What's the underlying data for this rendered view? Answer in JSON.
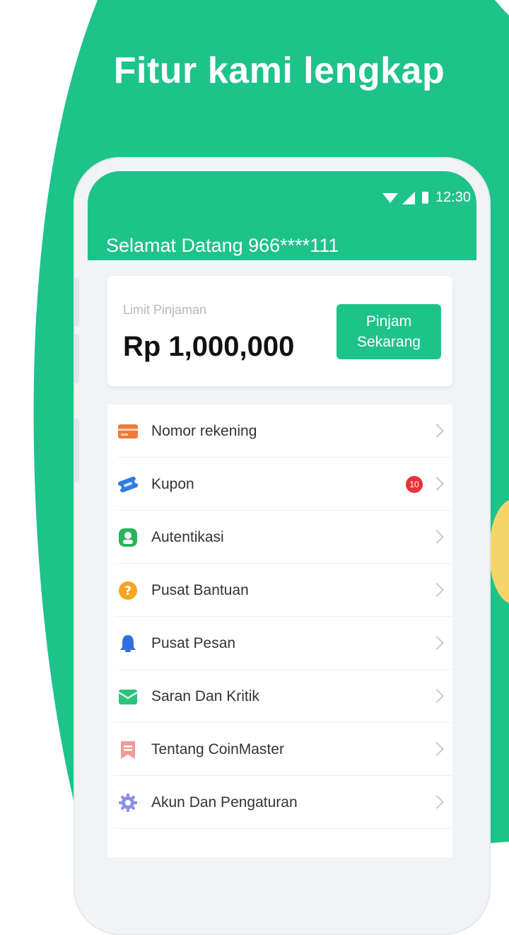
{
  "headline": "Fitur kami lengkap",
  "colors": {
    "brand": "#1ec38a",
    "badge": "#e8323b",
    "accent_yellow": "#f5d56a"
  },
  "status_bar": {
    "time": "12:30",
    "icons": [
      "wifi-icon",
      "signal-icon",
      "battery-icon"
    ]
  },
  "header": {
    "welcome": "Selamat Datang 966****111"
  },
  "loan": {
    "label": "Limit Pinjaman",
    "amount": "Rp 1,000,000",
    "button_line1": "Pinjam",
    "button_line2": "Sekarang"
  },
  "menu": {
    "items": [
      {
        "label": "Nomor rekening",
        "icon": "bank-card-icon"
      },
      {
        "label": "Kupon",
        "icon": "coupon-icon",
        "badge": "10"
      },
      {
        "label": "Autentikasi",
        "icon": "verification-icon"
      },
      {
        "label": "Pusat Bantuan",
        "icon": "help-icon"
      },
      {
        "label": "Pusat Pesan",
        "icon": "bell-icon"
      },
      {
        "label": "Saran Dan Kritik",
        "icon": "feedback-icon"
      },
      {
        "label": "Tentang CoinMaster",
        "icon": "info-ribbon-icon"
      },
      {
        "label": "Akun Dan Pengaturan",
        "icon": "settings-gear-icon"
      }
    ]
  }
}
